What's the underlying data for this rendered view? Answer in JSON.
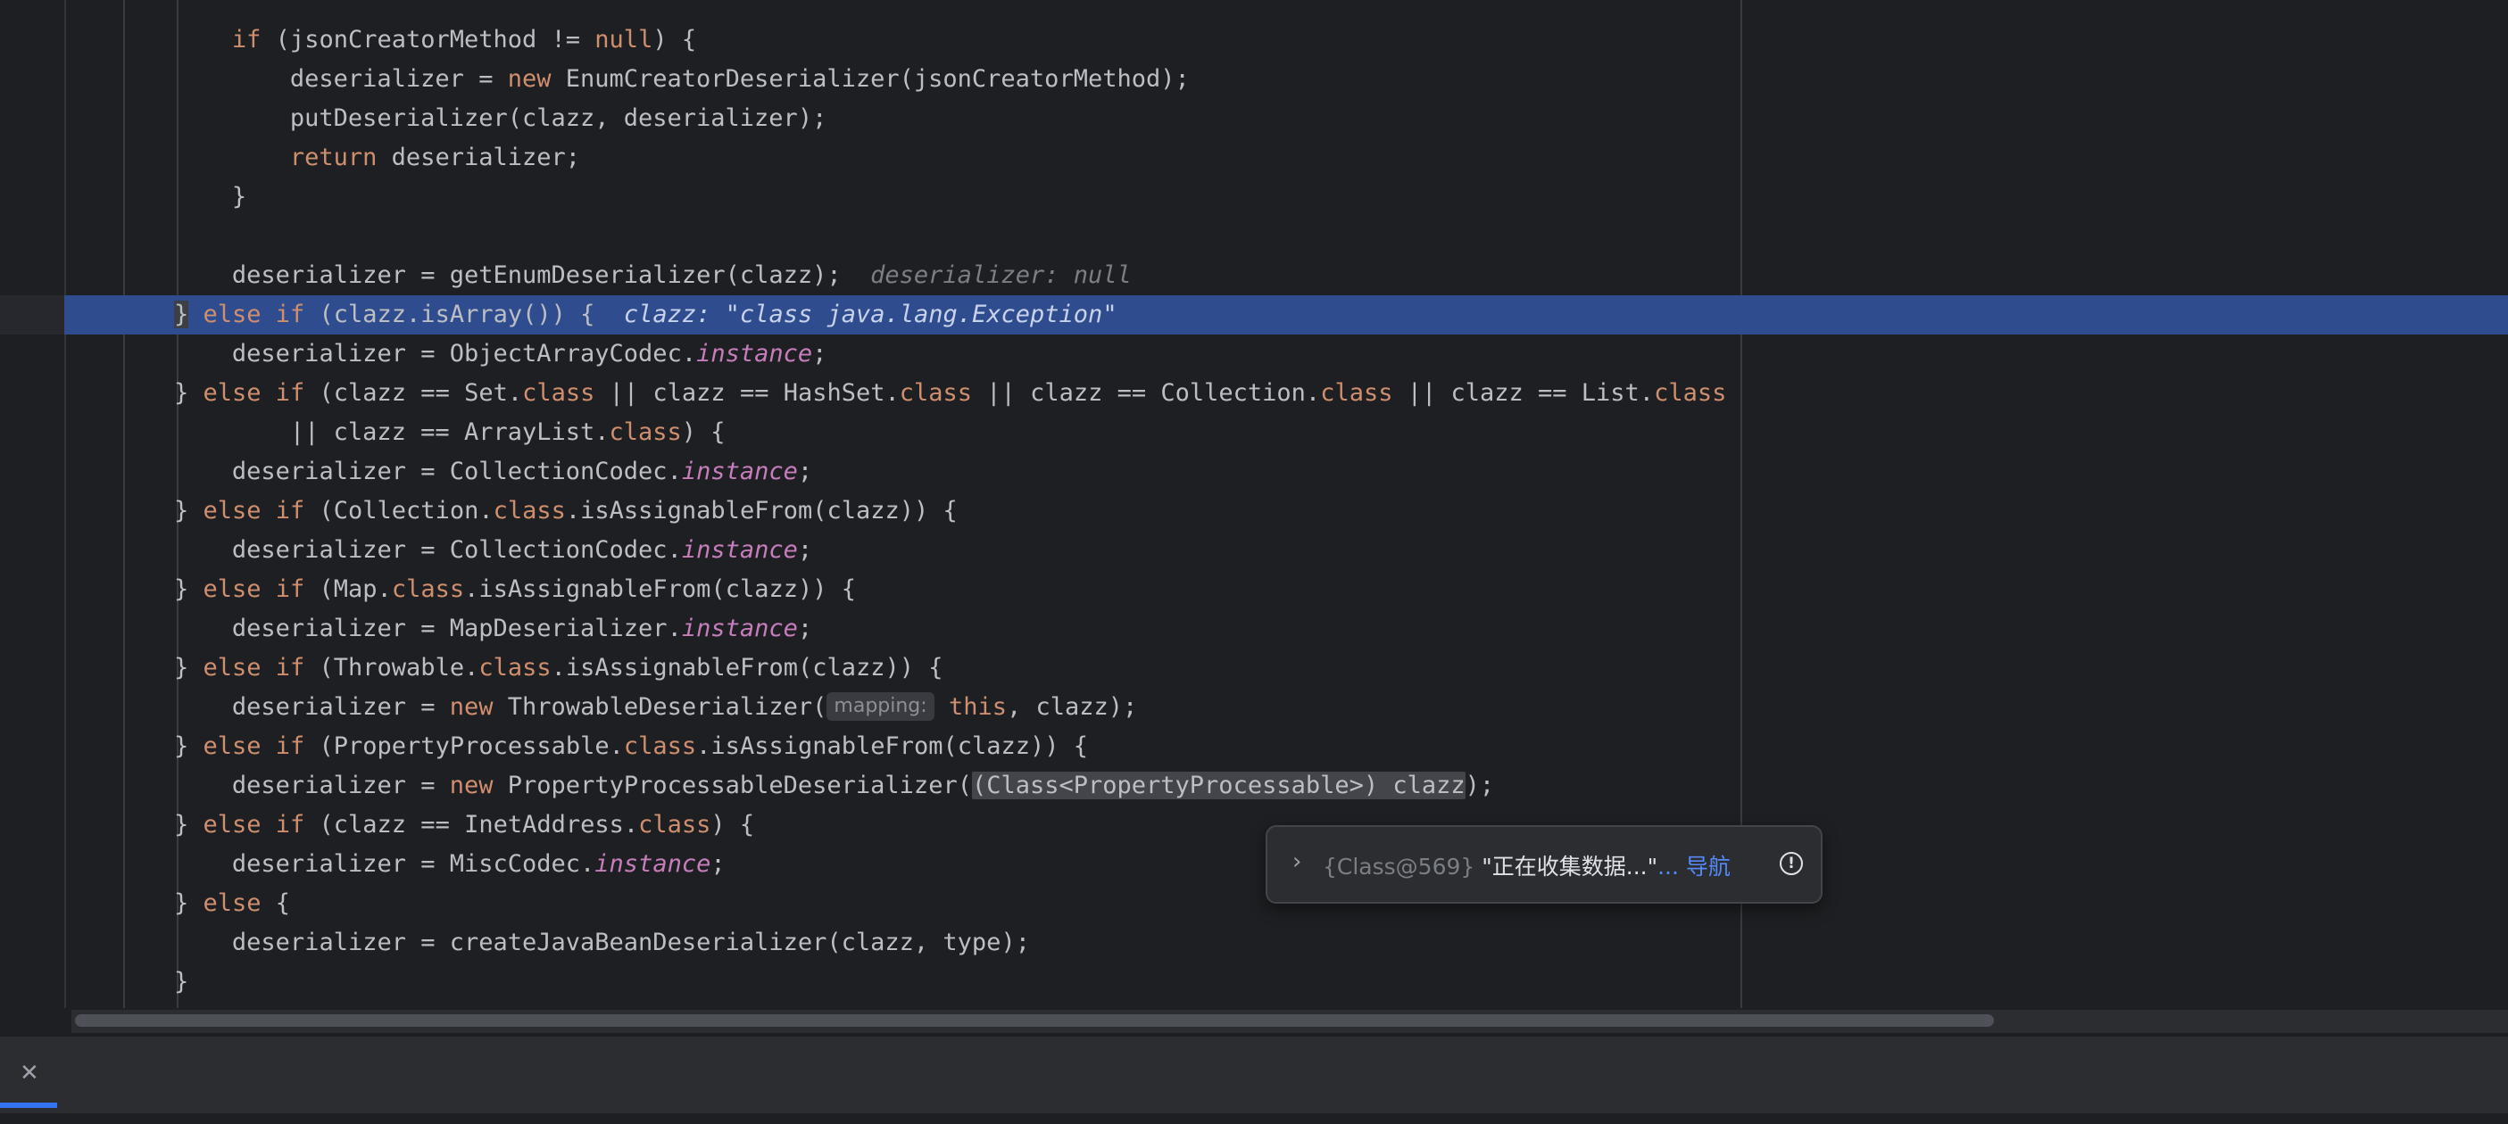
{
  "editor": {
    "lines": [
      {
        "indent": 8,
        "tokens": [
          {
            "k": "kw",
            "t": "if"
          },
          {
            "t": " (jsonCreatorMethod != "
          },
          {
            "k": "kw",
            "t": "null"
          },
          {
            "t": ") {"
          }
        ]
      },
      {
        "indent": 12,
        "tokens": [
          {
            "t": "deserializer = "
          },
          {
            "k": "kw",
            "t": "new"
          },
          {
            "t": " EnumCreatorDeserializer(jsonCreatorMethod);"
          }
        ]
      },
      {
        "indent": 12,
        "tokens": [
          {
            "t": "putDeserializer(clazz, deserializer);"
          }
        ]
      },
      {
        "indent": 12,
        "tokens": [
          {
            "k": "kw",
            "t": "return"
          },
          {
            "t": " deserializer;"
          }
        ]
      },
      {
        "indent": 8,
        "tokens": [
          {
            "t": "}"
          }
        ]
      },
      {
        "indent": 0,
        "tokens": []
      },
      {
        "indent": 8,
        "tokens": [
          {
            "t": "deserializer = getEnumDeserializer(clazz);"
          },
          {
            "k": "hint",
            "t": "  deserializer: null"
          }
        ]
      },
      {
        "indent": 4,
        "current": true,
        "tokens": [
          {
            "k": "brace",
            "t": "}"
          },
          {
            "k": "kw",
            "t": " else if"
          },
          {
            "t": " (clazz.isArray()) {"
          },
          {
            "k": "hintcur",
            "t": "  clazz: \"class java.lang.Exception\""
          }
        ]
      },
      {
        "indent": 8,
        "tokens": [
          {
            "t": "deserializer = ObjectArrayCodec."
          },
          {
            "k": "it",
            "t": "instance"
          },
          {
            "t": ";"
          }
        ]
      },
      {
        "indent": 4,
        "tokens": [
          {
            "t": "} "
          },
          {
            "k": "kw",
            "t": "else if"
          },
          {
            "t": " (clazz == Set."
          },
          {
            "k": "kw",
            "t": "class"
          },
          {
            "t": " || clazz == HashSet."
          },
          {
            "k": "kw",
            "t": "class"
          },
          {
            "t": " || clazz == Collection."
          },
          {
            "k": "kw",
            "t": "class"
          },
          {
            "t": " || clazz == List."
          },
          {
            "k": "kw",
            "t": "class"
          }
        ]
      },
      {
        "indent": 12,
        "tokens": [
          {
            "t": "|| clazz == ArrayList."
          },
          {
            "k": "kw",
            "t": "class"
          },
          {
            "t": ") {"
          }
        ]
      },
      {
        "indent": 8,
        "tokens": [
          {
            "t": "deserializer = CollectionCodec."
          },
          {
            "k": "it",
            "t": "instance"
          },
          {
            "t": ";"
          }
        ]
      },
      {
        "indent": 4,
        "tokens": [
          {
            "t": "} "
          },
          {
            "k": "kw",
            "t": "else if"
          },
          {
            "t": " (Collection."
          },
          {
            "k": "kw",
            "t": "class"
          },
          {
            "t": ".isAssignableFrom(clazz)) {"
          }
        ]
      },
      {
        "indent": 8,
        "tokens": [
          {
            "t": "deserializer = CollectionCodec."
          },
          {
            "k": "it",
            "t": "instance"
          },
          {
            "t": ";"
          }
        ]
      },
      {
        "indent": 4,
        "tokens": [
          {
            "t": "} "
          },
          {
            "k": "kw",
            "t": "else if"
          },
          {
            "t": " (Map."
          },
          {
            "k": "kw",
            "t": "class"
          },
          {
            "t": ".isAssignableFrom(clazz)) {"
          }
        ]
      },
      {
        "indent": 8,
        "tokens": [
          {
            "t": "deserializer = MapDeserializer."
          },
          {
            "k": "it",
            "t": "instance"
          },
          {
            "t": ";"
          }
        ]
      },
      {
        "indent": 4,
        "tokens": [
          {
            "t": "} "
          },
          {
            "k": "kw",
            "t": "else if"
          },
          {
            "t": " (Throwable."
          },
          {
            "k": "kw",
            "t": "class"
          },
          {
            "t": ".isAssignableFrom(clazz)) {"
          }
        ]
      },
      {
        "indent": 8,
        "tokens": [
          {
            "t": "deserializer = "
          },
          {
            "k": "kw",
            "t": "new"
          },
          {
            "t": " ThrowableDeserializer("
          },
          {
            "k": "chip",
            "t": "mapping:"
          },
          {
            "t": " "
          },
          {
            "k": "kw",
            "t": "this"
          },
          {
            "t": ", clazz);"
          }
        ]
      },
      {
        "indent": 4,
        "tokens": [
          {
            "t": "} "
          },
          {
            "k": "kw",
            "t": "else if"
          },
          {
            "t": " (PropertyProcessable."
          },
          {
            "k": "kw",
            "t": "class"
          },
          {
            "t": ".isAssignableFrom(clazz)) {"
          }
        ]
      },
      {
        "indent": 8,
        "tokens": [
          {
            "t": "deserializer = "
          },
          {
            "k": "kw",
            "t": "new"
          },
          {
            "t": " PropertyProcessableDeserializer("
          },
          {
            "k": "sel",
            "t": "(Class<PropertyProcessable>) clazz"
          },
          {
            "t": ");"
          }
        ]
      },
      {
        "indent": 4,
        "tokens": [
          {
            "t": "} "
          },
          {
            "k": "kw",
            "t": "else if"
          },
          {
            "t": " (clazz == InetAddress."
          },
          {
            "k": "kw",
            "t": "class"
          },
          {
            "t": ") {"
          }
        ]
      },
      {
        "indent": 8,
        "tokens": [
          {
            "t": "deserializer = MiscCodec."
          },
          {
            "k": "it",
            "t": "instance"
          },
          {
            "t": ";"
          }
        ]
      },
      {
        "indent": 4,
        "tokens": [
          {
            "t": "} "
          },
          {
            "k": "kw",
            "t": "else"
          },
          {
            "t": " {"
          }
        ]
      },
      {
        "indent": 8,
        "tokens": [
          {
            "t": "deserializer = createJavaBeanDeserializer(clazz, type);"
          }
        ]
      },
      {
        "indent": 4,
        "tokens": [
          {
            "t": "}"
          }
        ]
      }
    ]
  },
  "popup": {
    "type_label": "{Class@569}",
    "value": "\"正在收集数据...\"",
    "nav_link": "... 导航",
    "expand_icon": "chevron-right-icon",
    "info_icon": "info-circle-icon"
  },
  "bottom_panel": {
    "close_icon": "close-icon"
  },
  "colors": {
    "background": "#1e1f22",
    "keyword": "#cf8e6d",
    "static_field": "#c77dbb",
    "current_line": "#2f4d8e",
    "link": "#548af7"
  }
}
